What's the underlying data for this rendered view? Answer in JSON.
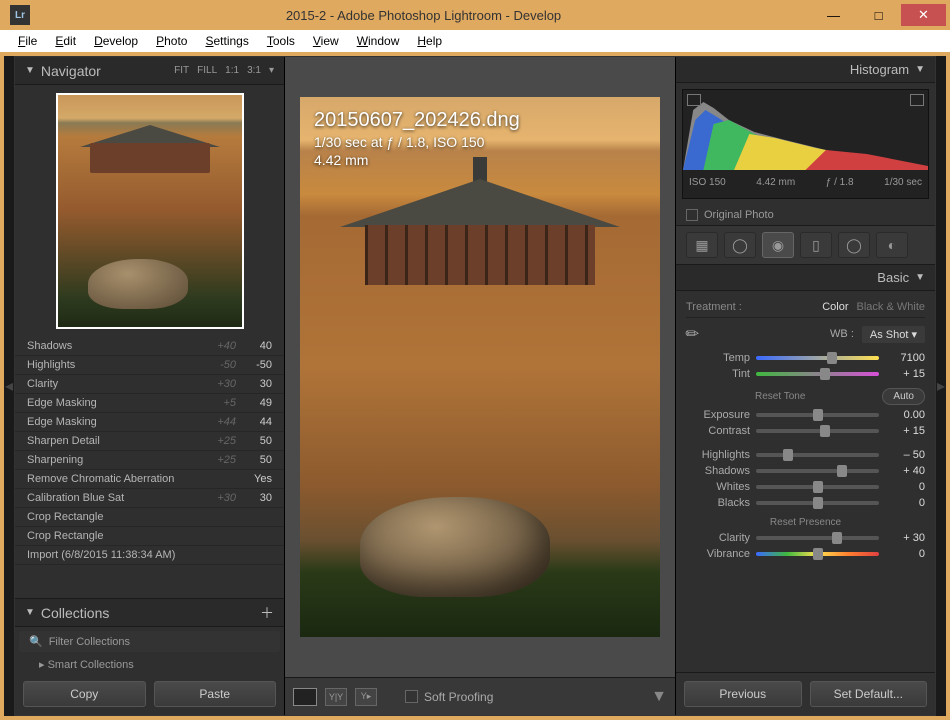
{
  "titlebar": {
    "app_icon_text": "Lr",
    "title": "2015-2 - Adobe Photoshop Lightroom - Develop"
  },
  "menubar": [
    "File",
    "Edit",
    "Develop",
    "Photo",
    "Settings",
    "Tools",
    "View",
    "Window",
    "Help"
  ],
  "navigator": {
    "title": "Navigator",
    "modes": [
      "FIT",
      "FILL",
      "1:1",
      "3:1"
    ]
  },
  "history": {
    "rows": [
      {
        "name": "Shadows",
        "v1": "+40",
        "v2": "40"
      },
      {
        "name": "Highlights",
        "v1": "-50",
        "v2": "-50"
      },
      {
        "name": "Clarity",
        "v1": "+30",
        "v2": "30"
      },
      {
        "name": "Edge Masking",
        "v1": "+5",
        "v2": "49"
      },
      {
        "name": "Edge Masking",
        "v1": "+44",
        "v2": "44"
      },
      {
        "name": "Sharpen Detail",
        "v1": "+25",
        "v2": "50"
      },
      {
        "name": "Sharpening",
        "v1": "+25",
        "v2": "50"
      },
      {
        "name": "Remove Chromatic Aberration",
        "v1": "",
        "v2": "Yes"
      },
      {
        "name": "Calibration Blue Sat",
        "v1": "+30",
        "v2": "30"
      },
      {
        "name": "Crop Rectangle",
        "v1": "",
        "v2": ""
      },
      {
        "name": "Crop Rectangle",
        "v1": "",
        "v2": ""
      },
      {
        "name": "Import (6/8/2015 11:38:34 AM)",
        "v1": "",
        "v2": ""
      }
    ]
  },
  "collections": {
    "title": "Collections",
    "filter_placeholder": "Filter Collections",
    "smart": "Smart Collections"
  },
  "left_buttons": {
    "copy": "Copy",
    "paste": "Paste"
  },
  "image_overlay": {
    "filename": "20150607_202426.dng",
    "exposure": "1/30 sec at ƒ / 1.8, ISO 150",
    "focal": "4.42 mm"
  },
  "center_toolbar": {
    "soft_proofing": "Soft Proofing"
  },
  "histogram": {
    "title": "Histogram",
    "meta": {
      "iso": "ISO 150",
      "focal": "4.42 mm",
      "aperture": "ƒ / 1.8",
      "shutter": "1/30 sec"
    },
    "original": "Original Photo"
  },
  "basic": {
    "title": "Basic",
    "treatment_label": "Treatment :",
    "color": "Color",
    "bw": "Black & White",
    "wb_label": "WB :",
    "wb_value": "As Shot",
    "tone_label": "Reset Tone",
    "auto": "Auto",
    "presence_label": "Reset Presence",
    "sliders": {
      "temp": {
        "label": "Temp",
        "value": "7100",
        "pos": 62
      },
      "tint": {
        "label": "Tint",
        "value": "+ 15",
        "pos": 56
      },
      "exposure": {
        "label": "Exposure",
        "value": "0.00",
        "pos": 50
      },
      "contrast": {
        "label": "Contrast",
        "value": "+ 15",
        "pos": 56
      },
      "highlights": {
        "label": "Highlights",
        "value": "– 50",
        "pos": 26
      },
      "shadows": {
        "label": "Shadows",
        "value": "+ 40",
        "pos": 70
      },
      "whites": {
        "label": "Whites",
        "value": "0",
        "pos": 50
      },
      "blacks": {
        "label": "Blacks",
        "value": "0",
        "pos": 50
      },
      "clarity": {
        "label": "Clarity",
        "value": "+ 30",
        "pos": 66
      },
      "vibrance": {
        "label": "Vibrance",
        "value": "0",
        "pos": 50
      }
    }
  },
  "right_buttons": {
    "previous": "Previous",
    "reset": "Set Default..."
  }
}
